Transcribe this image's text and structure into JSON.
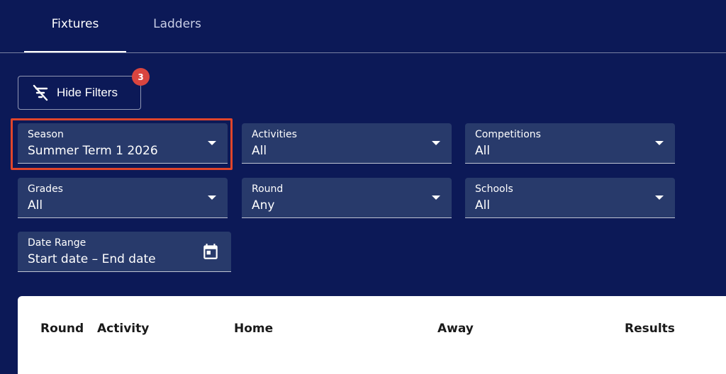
{
  "tabs": [
    {
      "label": "Fixtures",
      "active": true
    },
    {
      "label": "Ladders",
      "active": false
    }
  ],
  "filters_button": {
    "label": "Hide Filters",
    "badge_count": "3",
    "icon": "filter-off-icon"
  },
  "filters": {
    "season": {
      "label": "Season",
      "value": "Summer Term 1 2026"
    },
    "activities": {
      "label": "Activities",
      "value": "All"
    },
    "competitions": {
      "label": "Competitions",
      "value": "All"
    },
    "grades": {
      "label": "Grades",
      "value": "All"
    },
    "round": {
      "label": "Round",
      "value": "Any"
    },
    "schools": {
      "label": "Schools",
      "value": "All"
    },
    "date_range": {
      "label": "Date Range",
      "value": "Start date – End date",
      "icon": "calendar-icon"
    }
  },
  "table": {
    "headers": [
      "Round",
      "Activity",
      "Home",
      "Away",
      "Results"
    ]
  },
  "colors": {
    "background": "#0c1957",
    "field_bg": "#283a6b",
    "badge": "#d9453f",
    "highlight": "#e0452b"
  }
}
